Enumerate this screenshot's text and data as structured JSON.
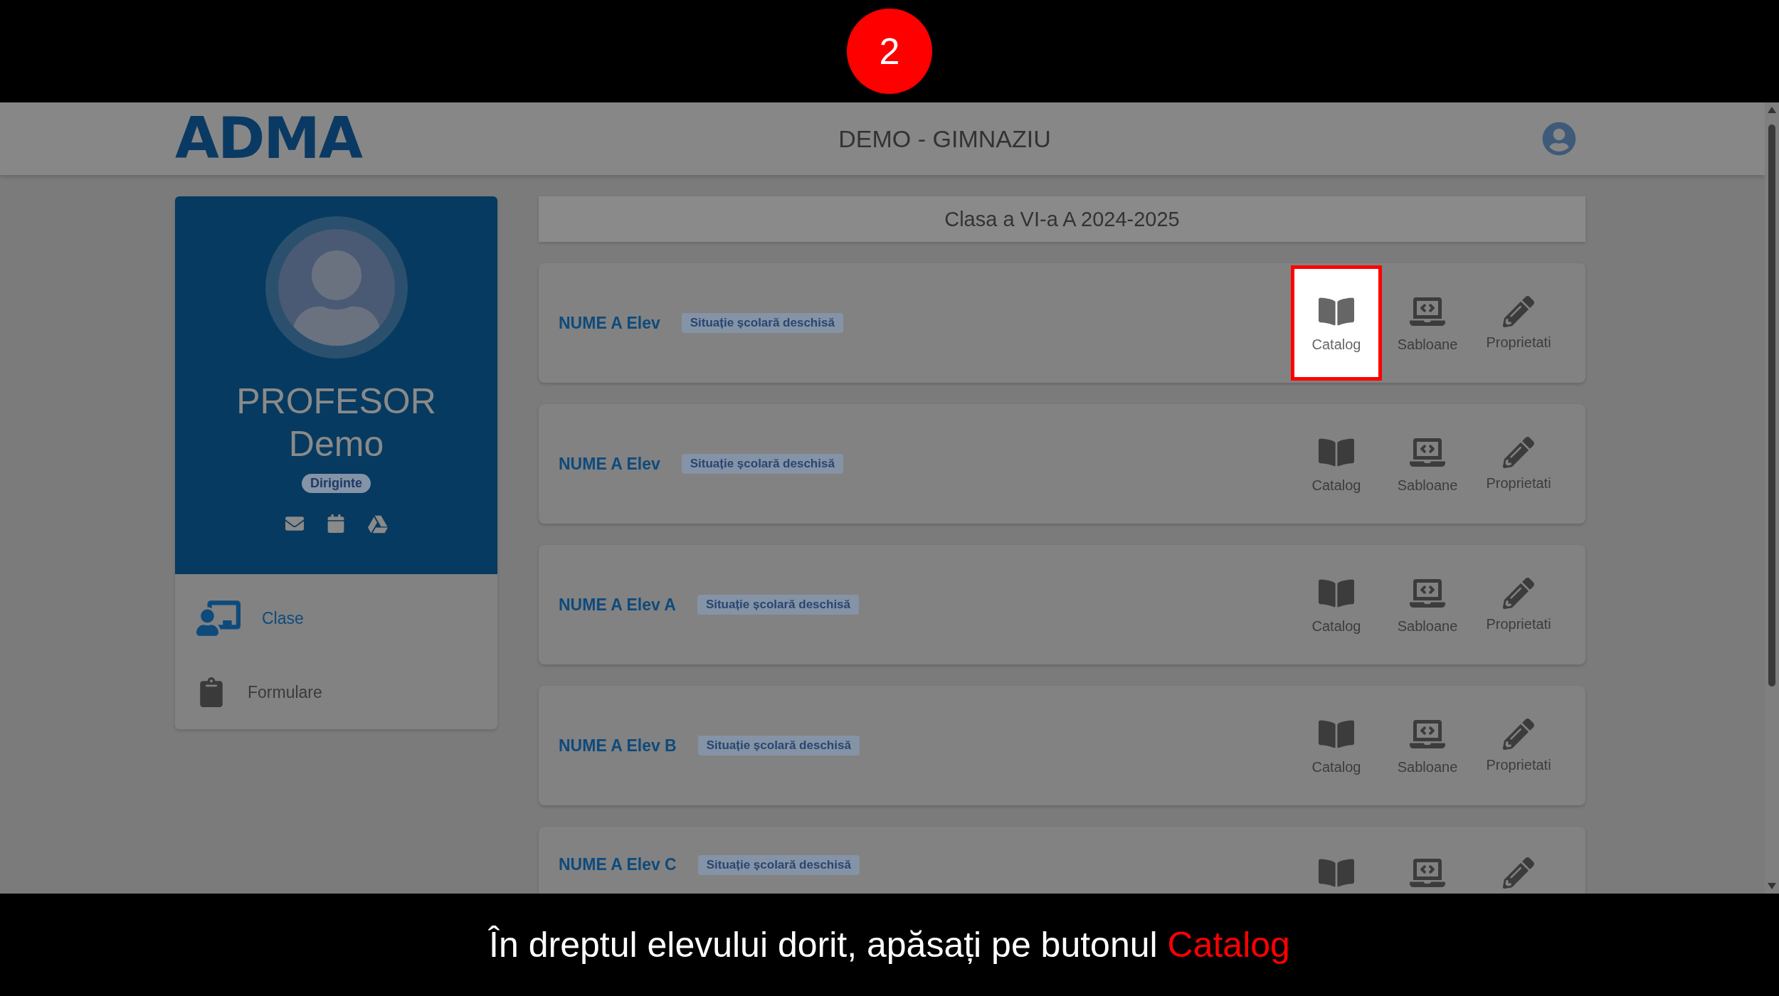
{
  "step": {
    "number": "2"
  },
  "header": {
    "title": "DEMO - GIMNAZIU",
    "logo": "ADMA"
  },
  "profile": {
    "line1": "PROFESOR",
    "line2": "Demo",
    "role": "Diriginte"
  },
  "menu": [
    {
      "kind": "classes",
      "label": "Clase",
      "selected": true
    },
    {
      "kind": "forms",
      "label": "Formulare",
      "selected": false
    }
  ],
  "class_title": "Clasa a VI-a A 2024-2025",
  "students": [
    {
      "name": "NUME A Elev",
      "status": "Situație școlară deschisă",
      "actions": [
        {
          "kind": "catalog",
          "label": "Catalog",
          "highlighted": true
        },
        {
          "kind": "template",
          "label": "Sabloane",
          "highlighted": false
        },
        {
          "kind": "edit",
          "label": "Proprietati",
          "highlighted": false
        }
      ]
    },
    {
      "name": "NUME A Elev",
      "status": "Situație școlară deschisă",
      "actions": [
        {
          "kind": "catalog",
          "label": "Catalog",
          "highlighted": false
        },
        {
          "kind": "template",
          "label": "Sabloane",
          "highlighted": false
        },
        {
          "kind": "edit",
          "label": "Proprietati",
          "highlighted": false
        }
      ]
    },
    {
      "name": "NUME A Elev A",
      "status": "Situație școlară deschisă",
      "actions": [
        {
          "kind": "catalog",
          "label": "Catalog",
          "highlighted": false
        },
        {
          "kind": "template",
          "label": "Sabloane",
          "highlighted": false
        },
        {
          "kind": "edit",
          "label": "Proprietati",
          "highlighted": false
        }
      ]
    },
    {
      "name": "NUME A Elev B",
      "status": "Situație școlară deschisă",
      "actions": [
        {
          "kind": "catalog",
          "label": "Catalog",
          "highlighted": false
        },
        {
          "kind": "template",
          "label": "Sabloane",
          "highlighted": false
        },
        {
          "kind": "edit",
          "label": "Proprietati",
          "highlighted": false
        }
      ]
    },
    {
      "name": "NUME A Elev C",
      "status": "Situație școlară deschisă",
      "actions": [
        {
          "kind": "catalog",
          "highlighted": false
        },
        {
          "kind": "template",
          "highlighted": false
        },
        {
          "kind": "edit",
          "highlighted": false
        }
      ]
    }
  ],
  "caption": {
    "text": "În dreptul elevului dorit, apăsați pe butonul ",
    "highlight": "Catalog"
  }
}
